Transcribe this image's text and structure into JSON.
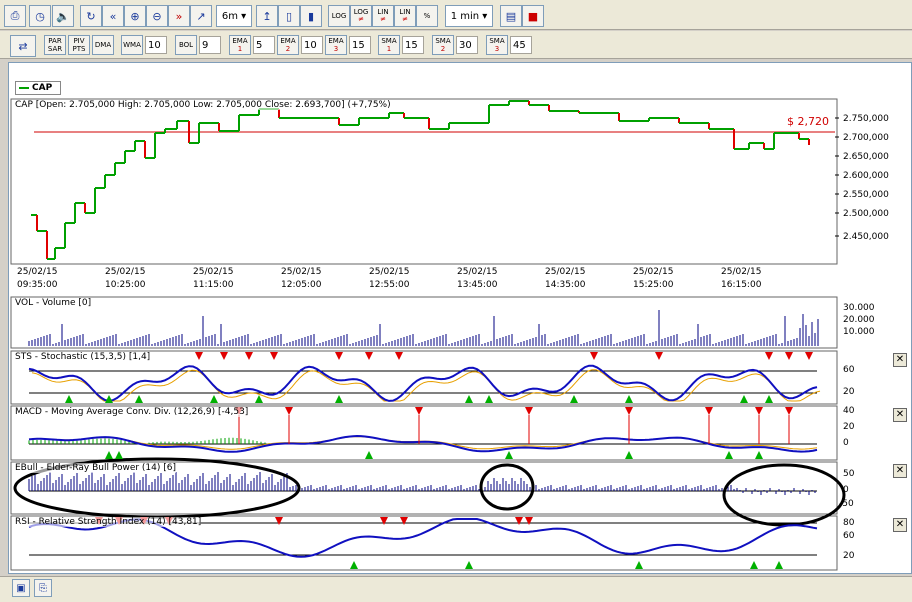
{
  "toolbar1": {
    "timeframe": "6m",
    "interval": "1 min",
    "log1": "LOG",
    "log2": "LOG",
    "lin1": "LIN",
    "lin2": "LIN",
    "pct": "%"
  },
  "toolbar2": {
    "par": [
      "PAR",
      "SAR"
    ],
    "piv": [
      "PIV",
      "PTS"
    ],
    "dma": "DMA",
    "wma": "WMA",
    "wma_val": "10",
    "bol": "BOL",
    "bol_val": "9",
    "ema1": "EMA",
    "ema1_n": "1",
    "ema1_val": "5",
    "ema2": "EMA",
    "ema2_n": "2",
    "ema2_val": "10",
    "ema3": "EMA",
    "ema3_n": "3",
    "ema3_val": "15",
    "sma1": "SMA",
    "sma1_n": "1",
    "sma1_val": "15",
    "sma2": "SMA",
    "sma2_n": "2",
    "sma2_val": "30",
    "sma3": "SMA",
    "sma3_n": "3",
    "sma3_val": "45"
  },
  "legend": "CAP",
  "price_title": "CAP [Open: 2.705,000  High: 2.705,000  Low: 2.705,000  Close: 2.693,700] (+7,75%)",
  "price_label": "$ 2,720",
  "price_axis": [
    "2.750,000",
    "2.700,000",
    "2.650,000",
    "2.600,000",
    "2.550,000",
    "2.500,000",
    "2.450,000"
  ],
  "x_dates": [
    "25/02/15",
    "25/02/15",
    "25/02/15",
    "25/02/15",
    "25/02/15",
    "25/02/15",
    "25/02/15",
    "25/02/15",
    "25/02/15"
  ],
  "x_times": [
    "09:35:00",
    "10:25:00",
    "11:15:00",
    "12:05:00",
    "12:55:00",
    "13:45:00",
    "14:35:00",
    "15:25:00",
    "16:15:00"
  ],
  "panels": {
    "vol": {
      "title": "VOL - Volume [0]",
      "axis": [
        "30.000",
        "20.000",
        "10.000"
      ]
    },
    "sts": {
      "title": "STS - Stochastic (15,3,5) [1,4]",
      "axis": [
        "60",
        "20"
      ]
    },
    "macd": {
      "title": "MACD - Moving Average Conv. Div. (12,26,9) [-4,53]",
      "axis": [
        "40",
        "20",
        "0"
      ]
    },
    "ebull": {
      "title": "EBull - Elder-Ray Bull Power (14) [6]",
      "axis": [
        "50",
        "0",
        "-50"
      ]
    },
    "rsi": {
      "title": "RSI - Relative Strength Index (14) [43,81]",
      "axis": [
        "80",
        "60",
        "20"
      ]
    }
  },
  "colors": {
    "up": "#00a000",
    "down": "#e00000",
    "line": "#1010c0",
    "signal": "#e8a000",
    "bar": "#000080"
  }
}
